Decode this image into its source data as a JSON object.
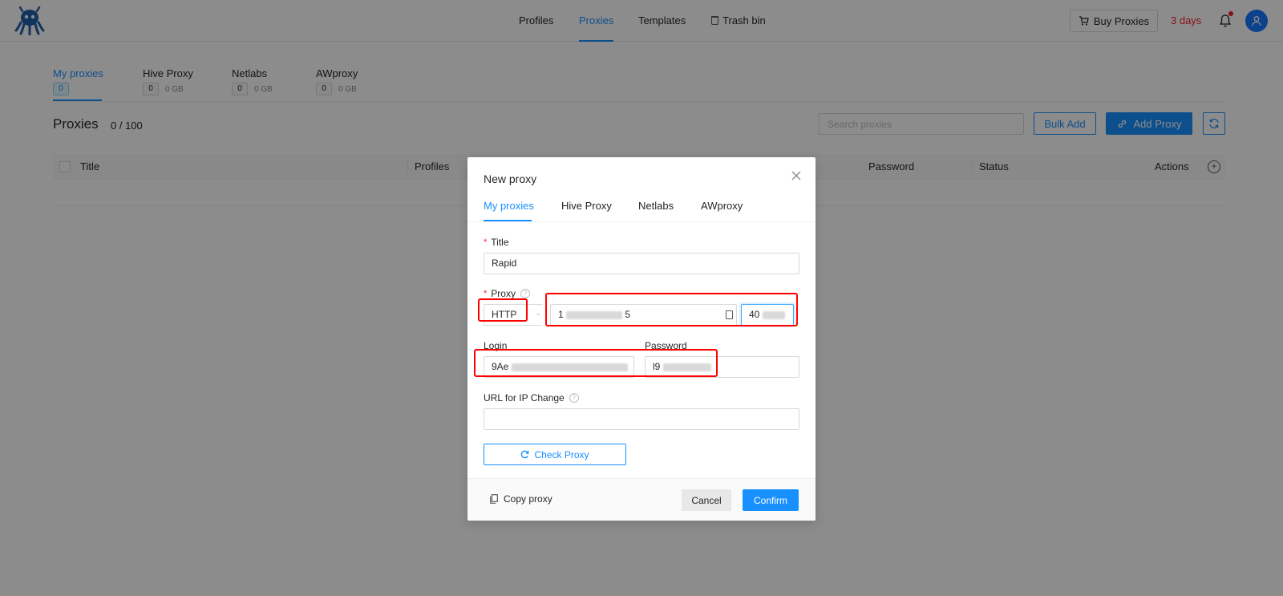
{
  "colors": {
    "accent": "#1890ff",
    "danger": "#f5222d",
    "highlight": "#ff0000"
  },
  "header": {
    "logo_icon": "octopus-logo",
    "nav": [
      {
        "label": "Profiles"
      },
      {
        "label": "Proxies",
        "active": true
      },
      {
        "label": "Templates"
      },
      {
        "label": "Trash bin",
        "icon": "trash-icon"
      }
    ],
    "buy_label": "Buy Proxies",
    "days_label": "3 days",
    "bell_icon": "bell-icon",
    "avatar_icon": "user-icon"
  },
  "providers": [
    {
      "name": "My proxies",
      "count": "0",
      "active": true
    },
    {
      "name": "Hive Proxy",
      "count": "0",
      "gb": "0 GB"
    },
    {
      "name": "Netlabs",
      "count": "0",
      "gb": "0 GB"
    },
    {
      "name": "AWproxy",
      "count": "0",
      "gb": "0 GB"
    }
  ],
  "list": {
    "title": "Proxies",
    "count": "0 / 100",
    "search_placeholder": "Search proxies",
    "bulk_add": "Bulk Add",
    "add_proxy": "Add Proxy",
    "columns": [
      "Title",
      "Profiles",
      "Password",
      "Status",
      "Actions"
    ]
  },
  "modal": {
    "title": "New proxy",
    "tabs": [
      {
        "label": "My proxies",
        "active": true
      },
      {
        "label": "Hive Proxy"
      },
      {
        "label": "Netlabs"
      },
      {
        "label": "AWproxy"
      }
    ],
    "title_label": "Title",
    "title_value": "Rapid",
    "proxy_label": "Proxy",
    "proxy_type": "HTTP",
    "host_start": "1",
    "host_end": "5",
    "port_start": "40",
    "login_label": "Login",
    "login_start": "9Ae",
    "password_label": "Password",
    "password_start": "l9",
    "ip_change_label": "URL for IP Change",
    "ip_change_value": "",
    "check_proxy": "Check Proxy",
    "copy_proxy": "Copy proxy",
    "cancel": "Cancel",
    "confirm": "Confirm"
  }
}
